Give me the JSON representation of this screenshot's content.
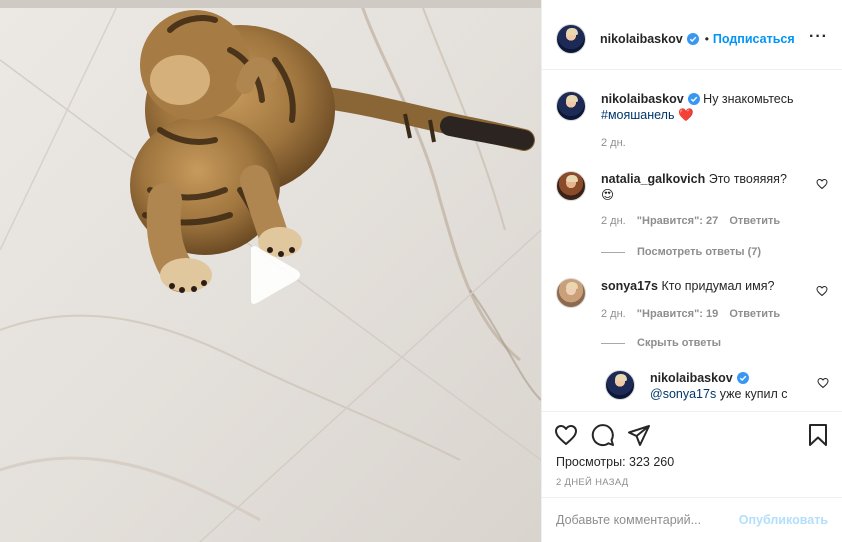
{
  "media": {
    "top_caption": "",
    "play_icon": "play-icon"
  },
  "header": {
    "username": "nikolaibaskov",
    "separator": "•",
    "follow_label": "Подписаться",
    "more_icon": "more-icon"
  },
  "caption": {
    "username": "nikolaibaskov",
    "text": "Ну знакомьтесь",
    "hashtag": "#мояшанель",
    "emoji": "❤️",
    "time": "2 дн."
  },
  "comments": [
    {
      "username": "natalia_galkovich",
      "text": "Это твояяяя?",
      "emoji": "😍",
      "time": "2 дн.",
      "likes": "\"Нравится\": 27",
      "reply_label": "Ответить",
      "replies_toggle": "Посмотреть ответы (7)"
    },
    {
      "username": "sonya17s",
      "text": "Кто придумал имя?",
      "time": "2 дн.",
      "likes": "\"Нравится\": 19",
      "reply_label": "Ответить",
      "replies_toggle": "Скрыть ответы"
    }
  ],
  "reply": {
    "username": "nikolaibaskov",
    "mention": "@sonya17s",
    "text": "уже купил с"
  },
  "actions": {
    "like_icon": "heart-icon",
    "comment_icon": "comment-icon",
    "share_icon": "share-icon",
    "save_icon": "bookmark-icon",
    "views_label": "Просмотры:",
    "views_count": "323 260",
    "date": "2 дней назад"
  },
  "add_comment": {
    "placeholder": "Добавьте комментарий...",
    "post_label": "Опубликовать"
  },
  "colors": {
    "accent": "#0095f6",
    "post_disabled": "#b2dffc",
    "secondary_text": "#8e8e8e",
    "hashtag": "#00376b",
    "heart": "#ed4956"
  }
}
